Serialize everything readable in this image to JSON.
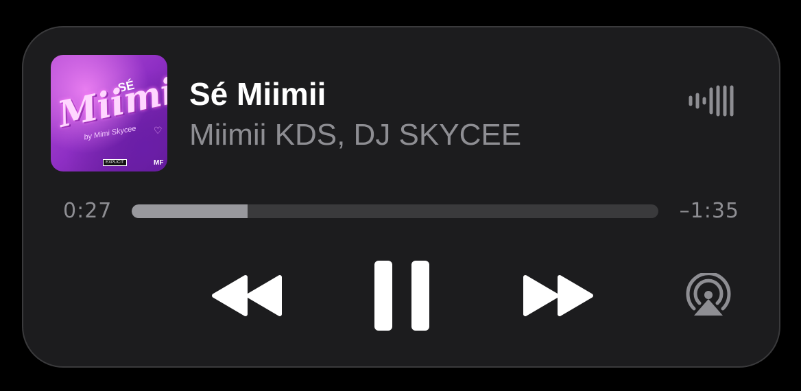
{
  "track": {
    "title": "Sé Miimii",
    "artist": "Miimii KDS, DJ SKYCEE"
  },
  "artwork": {
    "title_text": "Miimii",
    "small_text": "SÉ",
    "sub_text": "by Mimi Skycee",
    "label_mark": "MF",
    "parental_badge": "EXPLICIT"
  },
  "progress": {
    "elapsed": "0:27",
    "remaining": "–1:35",
    "fraction": 0.22
  },
  "icons": {
    "rewind": "backward-icon",
    "pause": "pause-icon",
    "forward": "forward-icon",
    "airplay": "airplay-icon",
    "waveform": "waveform-icon"
  },
  "colors": {
    "background": "#000000",
    "panel": "#1c1c1e",
    "primary_text": "#ffffff",
    "secondary_text": "#8e8e93",
    "progress_track": "#3a3a3c",
    "progress_fill": "#98989d"
  }
}
